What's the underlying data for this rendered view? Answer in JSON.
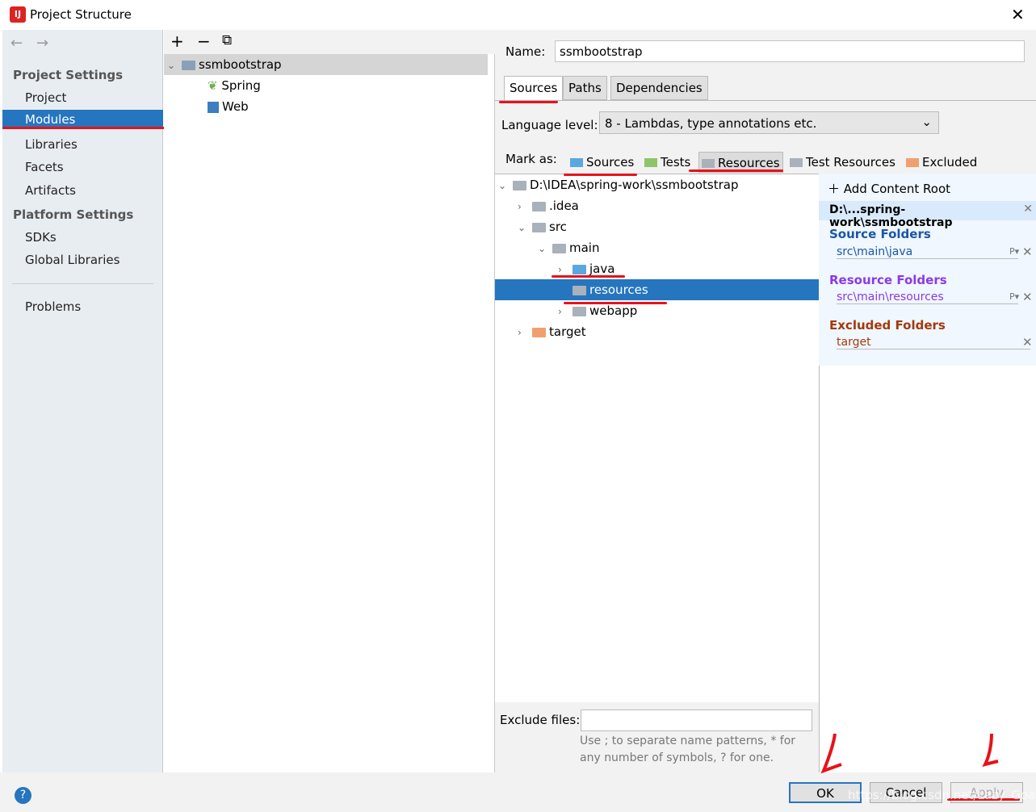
{
  "window": {
    "title": "Project Structure",
    "close": "✕"
  },
  "sidebar": {
    "back": "←",
    "forward": "→",
    "project_settings": "Project Settings",
    "items": [
      "Project",
      "Modules",
      "Libraries",
      "Facets",
      "Artifacts"
    ],
    "platform_settings": "Platform Settings",
    "platform_items": [
      "SDKs",
      "Global Libraries"
    ],
    "problems": "Problems"
  },
  "modules": {
    "toolbar": {
      "add": "+",
      "remove": "−",
      "copy": "⧉"
    },
    "tree": [
      {
        "label": "ssmbootstrap"
      },
      {
        "label": "Spring"
      },
      {
        "label": "Web"
      }
    ]
  },
  "module": {
    "name_label": "Name:",
    "name_value": "ssmbootstrap",
    "tabs": [
      "Sources",
      "Paths",
      "Dependencies"
    ],
    "language_label": "Language level:",
    "language_value": "8 - Lambdas, type annotations etc.",
    "mark_as": "Mark as:",
    "mark_buttons": [
      {
        "label": "Sources",
        "color": "#5aa8e0"
      },
      {
        "label": "Tests",
        "color": "#8fc46a"
      },
      {
        "label": "Resources",
        "color": "#a9b1ba"
      },
      {
        "label": "Test Resources",
        "color": "#a9b1ba"
      },
      {
        "label": "Excluded",
        "color": "#f0a070"
      }
    ],
    "tree": [
      {
        "label": "D:\\IDEA\\spring-work\\ssmbootstrap",
        "chev": "⌄"
      },
      {
        "label": ".idea",
        "chev": "›"
      },
      {
        "label": "src",
        "chev": "⌄"
      },
      {
        "label": "main",
        "chev": "⌄"
      },
      {
        "label": "java",
        "chev": "›"
      },
      {
        "label": "resources",
        "chev": ""
      },
      {
        "label": "webapp",
        "chev": "›"
      },
      {
        "label": "target",
        "chev": "›"
      }
    ],
    "content_root": {
      "add": "Add Content Root",
      "root": "D:\\...spring-work\\ssmbootstrap",
      "source_title": "Source Folders",
      "source_item": "src\\main\\java",
      "resource_title": "Resource Folders",
      "resource_item": "src\\main\\resources",
      "excluded_title": "Excluded Folders",
      "excluded_item": "target",
      "remove": "✕",
      "props": "P▾"
    },
    "exclude_label": "Exclude files:",
    "exclude_value": "",
    "exclude_hint1": "Use ; to separate name patterns, * for",
    "exclude_hint2": "any number of symbols, ? for one."
  },
  "footer": {
    "help": "?",
    "ok": "OK",
    "cancel": "Cancel",
    "apply": "Apply",
    "watermark": "https://blog.csdn.net/Lazy_Goat"
  },
  "colors": {
    "selection": "#2675bf",
    "source": "#1a56a8",
    "resource": "#8a3ae6",
    "excluded": "#a33a0a",
    "annotation": "#e8121a"
  }
}
